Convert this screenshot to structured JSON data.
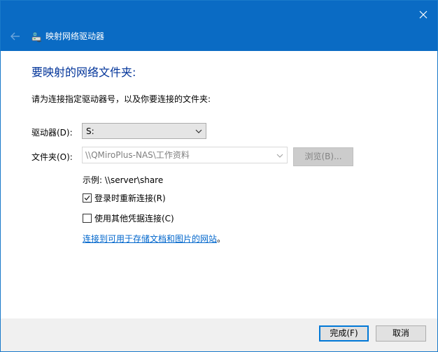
{
  "window": {
    "title": "映射网络驱动器"
  },
  "icons": {
    "close": "close-icon",
    "back": "back-arrow-icon",
    "title": "network-drive-icon",
    "drive_dropdown": "chevron-down-icon",
    "folder_dropdown": "chevron-down-icon",
    "checked": "checkmark-icon"
  },
  "content": {
    "heading": "要映射的网络文件夹:",
    "instruction": "请为连接指定驱动器号，以及你要连接的文件夹:",
    "drive_label": "驱动器(D):",
    "drive_value": "S:",
    "folder_label": "文件夹(O):",
    "folder_value": "\\\\QMiroPlus-NAS\\工作资料",
    "browse_label": "浏览(B)...",
    "example": "示例: \\\\server\\share",
    "reconnect_label": "登录时重新连接(R)",
    "reconnect_checked": true,
    "other_credentials_label": "使用其他凭据连接(C)",
    "other_credentials_checked": false,
    "link_text": "连接到可用于存储文档和图片的网站",
    "link_suffix": "。"
  },
  "footer": {
    "finish_label": "完成(F)",
    "cancel_label": "取消"
  },
  "colors": {
    "titlebar": "#0a6bc4",
    "heading": "#003399",
    "link": "#0066cc",
    "focus": "#0078d7"
  }
}
